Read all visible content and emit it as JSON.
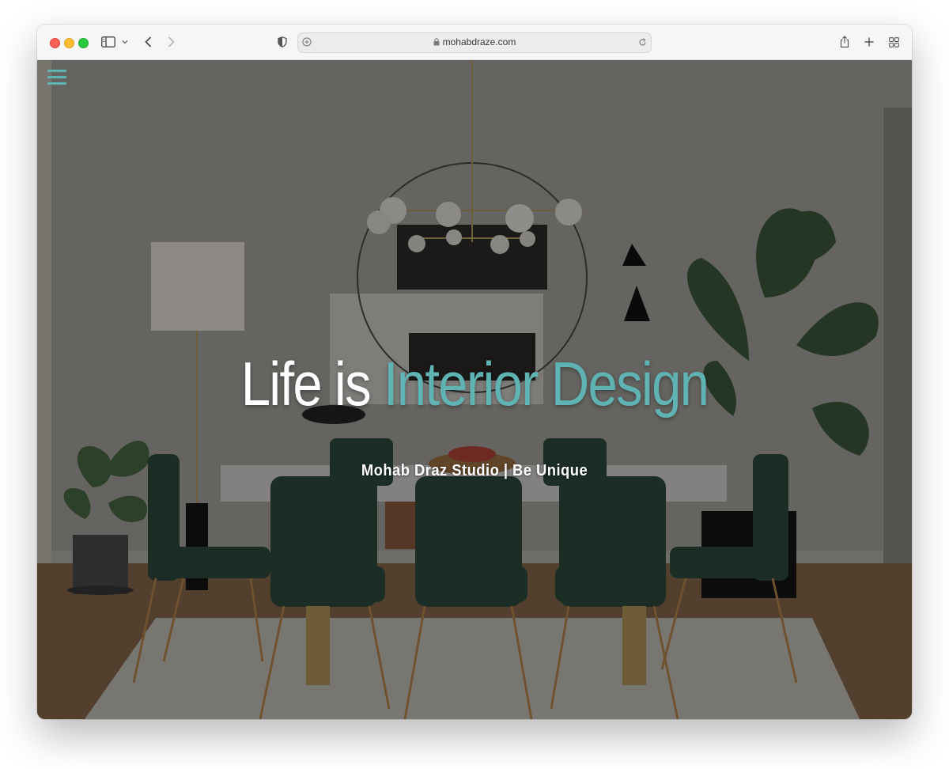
{
  "browser": {
    "url": "mohabdraze.com"
  },
  "hero": {
    "headline_white": "Life is",
    "headline_accent": "Interior Design",
    "subtitle": "Mohab Draz Studio | Be Unique"
  },
  "colors": {
    "accent": "#5fb3b3",
    "overlay": "rgba(0,0,0,0.40)"
  },
  "icons": {
    "menu": "hamburger-menu-icon",
    "sidebar": "sidebar-icon",
    "back": "chevron-left-icon",
    "forward": "chevron-right-icon",
    "privacy": "shield-icon",
    "lock": "lock-icon",
    "reload": "reload-icon",
    "share": "share-icon",
    "new_tab": "plus-icon",
    "tabs": "tab-overview-icon"
  }
}
